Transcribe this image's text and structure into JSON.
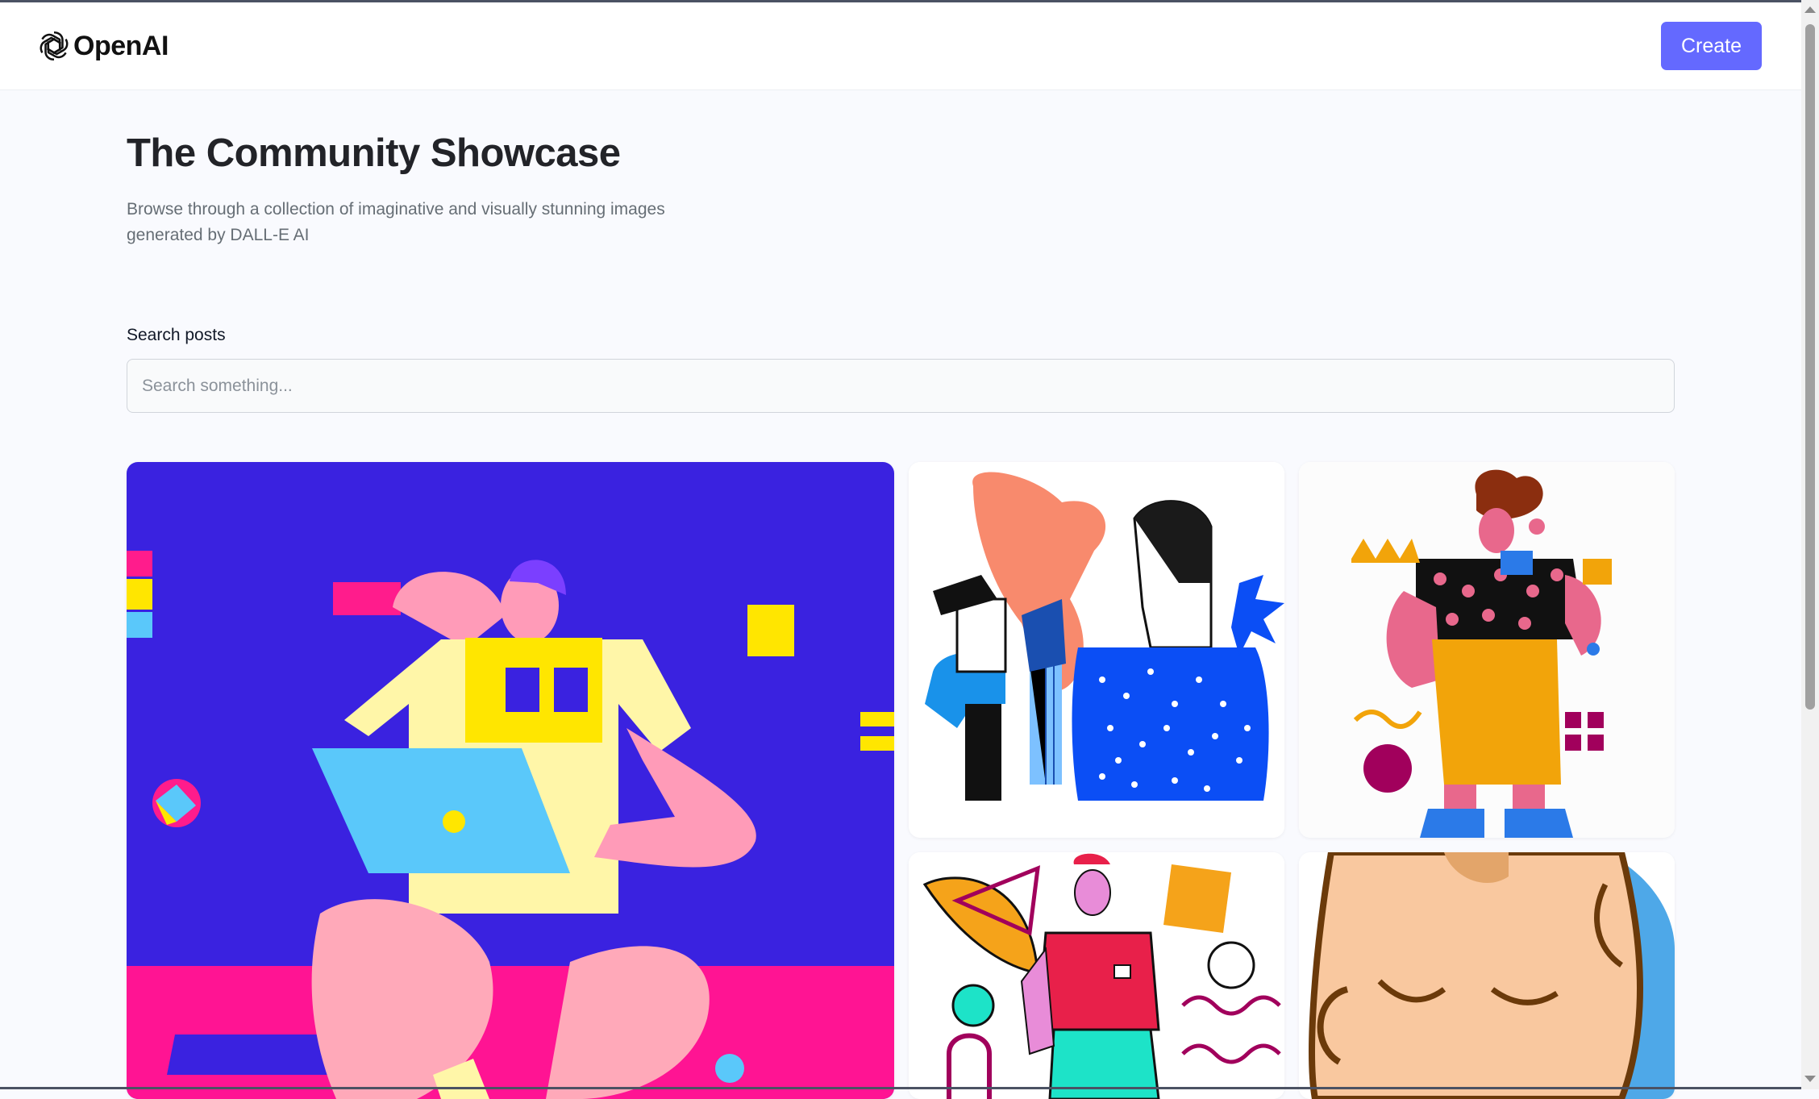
{
  "header": {
    "brand": "OpenAI",
    "logo_icon": "openai-logo-icon",
    "create_label": "Create",
    "accent": "#6469ff"
  },
  "main": {
    "title": "The Community Showcase",
    "subtitle": "Browse through a collection of imaginative and visually stunning images generated by DALL-E AI",
    "search": {
      "label": "Search posts",
      "placeholder": "Search something...",
      "value": ""
    }
  },
  "gallery": {
    "cards": [
      "illustration-person-laptop",
      "illustration-people-group",
      "illustration-man-flower",
      "illustration-man-shapes",
      "illustration-sleeping-face"
    ]
  }
}
